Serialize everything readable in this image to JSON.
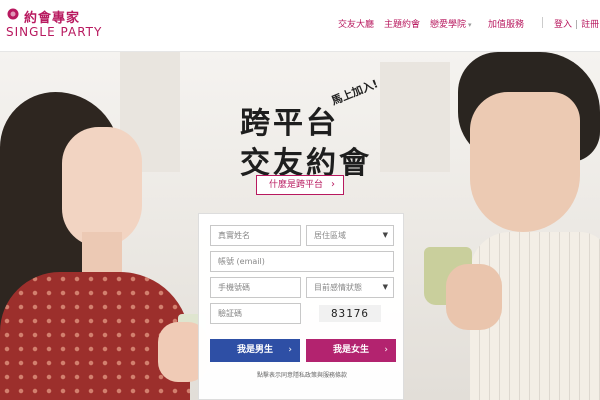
{
  "brand": {
    "name_cn": "約會專家",
    "name_en": "SINGLE PARTY",
    "color": "#b8195f"
  },
  "nav": {
    "items": [
      {
        "label": "交友大廳",
        "dropdown": false
      },
      {
        "label": "主題約會",
        "dropdown": false
      },
      {
        "label": "戀愛學院",
        "dropdown": true
      },
      {
        "label": "加值服務",
        "dropdown": false
      }
    ],
    "login": "登入",
    "register": "註冊"
  },
  "hero": {
    "tag": "馬上加入!",
    "headline_line1": "跨平台",
    "headline_line2": "交友約會",
    "why_button": "什麼是跨平台"
  },
  "form": {
    "name_placeholder": "真實姓名",
    "region_placeholder": "居住區域",
    "email_placeholder": "帳號 (email)",
    "phone_placeholder": "手機號碼",
    "status_placeholder": "目前感情狀態",
    "captcha_placeholder": "驗証碼",
    "captcha_code": "83176",
    "male_button": "我是男生",
    "female_button": "我是女生",
    "agreement_note": "點擊表示同意隱私政策與服務條款",
    "male_color": "#2e4fa5",
    "female_color": "#b3236f"
  },
  "icons": {
    "logo": "rose-heart-icon",
    "dropdown": "caret-down-icon",
    "button_arrow": "chevron-right-icon"
  }
}
